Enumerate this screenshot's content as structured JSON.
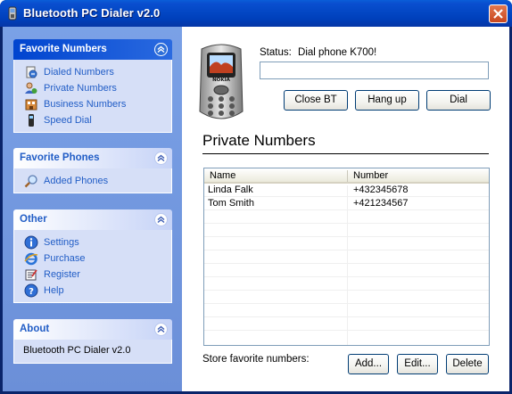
{
  "window": {
    "title": "Bluetooth PC Dialer v2.0"
  },
  "sidebar": {
    "panels": [
      {
        "title": "Favorite Numbers",
        "items": [
          {
            "label": "Dialed Numbers",
            "icon": "dialed-numbers-icon"
          },
          {
            "label": "Private Numbers",
            "icon": "private-numbers-icon"
          },
          {
            "label": "Business Numbers",
            "icon": "business-numbers-icon"
          },
          {
            "label": "Speed Dial",
            "icon": "speed-dial-icon"
          }
        ]
      },
      {
        "title": "Favorite Phones",
        "items": [
          {
            "label": "Added Phones",
            "icon": "magnifier-icon"
          }
        ]
      },
      {
        "title": "Other",
        "items": [
          {
            "label": "Settings",
            "icon": "info-icon"
          },
          {
            "label": "Purchase",
            "icon": "internet-explorer-icon"
          },
          {
            "label": "Register",
            "icon": "register-icon"
          },
          {
            "label": "Help",
            "icon": "help-icon"
          }
        ]
      },
      {
        "title": "About",
        "text": "Bluetooth PC Dialer v2.0"
      }
    ]
  },
  "main": {
    "status_label": "Status:",
    "status_value": "Dial phone K700!",
    "phone_brand": "NOKIA",
    "buttons": {
      "close_bt": "Close BT",
      "hang_up": "Hang up",
      "dial": "Dial"
    },
    "section_title": "Private Numbers",
    "table": {
      "columns": [
        "Name",
        "Number"
      ],
      "rows": [
        {
          "name": "Linda Falk",
          "number": "+432345678"
        },
        {
          "name": "Tom Smith",
          "number": "+421234567"
        }
      ]
    },
    "store_label": "Store favorite numbers:",
    "actions": {
      "add": "Add...",
      "edit": "Edit...",
      "delete": "Delete"
    }
  },
  "colors": {
    "titlebar": "#0347c4",
    "taskpane": "#6b8fd8",
    "link": "#215dc6"
  }
}
